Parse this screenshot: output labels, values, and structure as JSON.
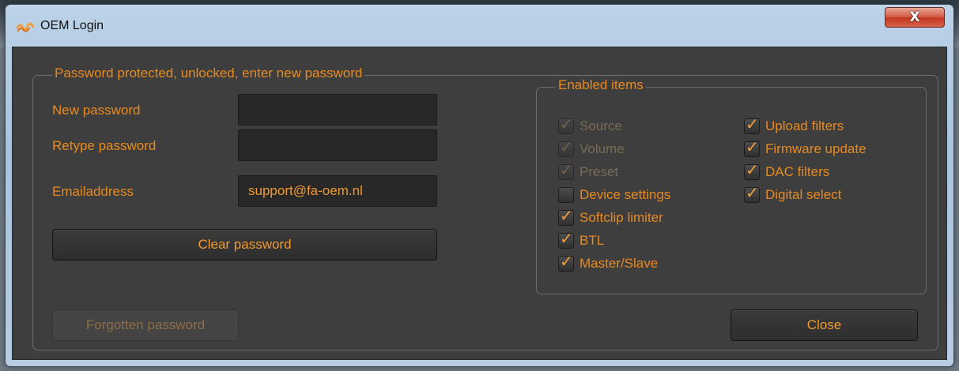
{
  "window": {
    "title": "OEM Login",
    "close_glyph": "X"
  },
  "password_group": {
    "legend": "Password protected, unlocked, enter new password",
    "new_password_label": "New password",
    "new_password_value": "",
    "retype_password_label": "Retype password",
    "retype_password_value": "",
    "email_label": "Emailaddress",
    "email_value": "support@fa-oem.nl",
    "clear_button": "Clear password"
  },
  "enabled_items": {
    "legend": "Enabled items",
    "left_items": [
      {
        "label": "Source",
        "checked": true,
        "enabled": false
      },
      {
        "label": "Volume",
        "checked": true,
        "enabled": false
      },
      {
        "label": "Preset",
        "checked": true,
        "enabled": false
      },
      {
        "label": "Device settings",
        "checked": false,
        "enabled": true
      },
      {
        "label": "Softclip limiter",
        "checked": true,
        "enabled": true
      },
      {
        "label": "BTL",
        "checked": true,
        "enabled": true
      },
      {
        "label": "Master/Slave",
        "checked": true,
        "enabled": true
      }
    ],
    "right_items": [
      {
        "label": "Upload filters",
        "checked": true,
        "enabled": true
      },
      {
        "label": "Firmware update",
        "checked": true,
        "enabled": true
      },
      {
        "label": "DAC filters",
        "checked": true,
        "enabled": true
      },
      {
        "label": "Digital select",
        "checked": true,
        "enabled": true
      }
    ]
  },
  "footer": {
    "forgotten_button": "Forgotten password",
    "close_button": "Close"
  },
  "colors": {
    "accent": "#e98a1f",
    "background": "#3e3e3e",
    "field_background": "#282828"
  },
  "icons": {
    "app": "orange-wave-logo-icon",
    "checkmark": "check-icon",
    "close": "close-icon"
  }
}
